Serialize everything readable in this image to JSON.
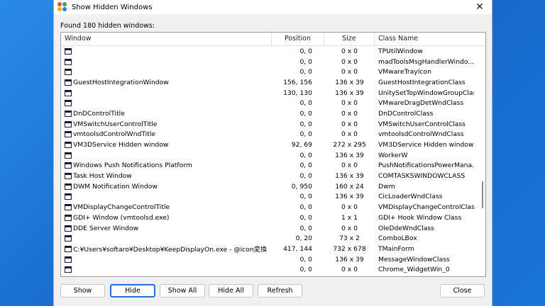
{
  "window": {
    "title": "Show Hidden Windows",
    "close_glyph": "✕"
  },
  "found_label": "Found 180 hidden windows:",
  "columns": {
    "window": "Window",
    "position": "Position",
    "size": "Size",
    "class_name": "Class Name"
  },
  "rows": [
    {
      "window": "",
      "position": "0, 0",
      "size": "0 x 0",
      "class_name": "TPUtilWindow"
    },
    {
      "window": "",
      "position": "0, 0",
      "size": "0 x 0",
      "class_name": "madToolsMsgHandlerWindo..."
    },
    {
      "window": "",
      "position": "0, 0",
      "size": "0 x 0",
      "class_name": "VMwareTrayIcon"
    },
    {
      "window": "GuestHostIntegrationWindow",
      "position": "156, 156",
      "size": "136 x 39",
      "class_name": "GuestHostIntegrationClass"
    },
    {
      "window": "",
      "position": "130, 130",
      "size": "136 x 39",
      "class_name": "UnitySetTopWindowGroupClass"
    },
    {
      "window": "",
      "position": "0, 0",
      "size": "0 x 0",
      "class_name": "VMwareDragDetWndClass"
    },
    {
      "window": "DnDControlTitle",
      "position": "0, 0",
      "size": "0 x 0",
      "class_name": "DnDControlClass"
    },
    {
      "window": "VMSwitchUserControlTitle",
      "position": "0, 0",
      "size": "0 x 0",
      "class_name": "VMSwitchUserControlClass"
    },
    {
      "window": "vmtoolsdControlWndTitle",
      "position": "0, 0",
      "size": "0 x 0",
      "class_name": "vmtoolsdControlWndClass"
    },
    {
      "window": "VM3DService Hidden window",
      "position": "92, 69",
      "size": "272 x 295",
      "class_name": "VM3DService Hidden window"
    },
    {
      "window": "",
      "position": "0, 0",
      "size": "136 x 39",
      "class_name": "WorkerW"
    },
    {
      "window": "Windows Push Notifications Platform",
      "position": "0, 0",
      "size": "0 x 0",
      "class_name": "PushNotificationsPowerMana..."
    },
    {
      "window": "Task Host Window",
      "position": "0, 0",
      "size": "136 x 39",
      "class_name": "COMTASKSWINDOWCLASS"
    },
    {
      "window": "DWM Notification Window",
      "position": "0, 950",
      "size": "160 x 24",
      "class_name": "Dwm"
    },
    {
      "window": "",
      "position": "0, 0",
      "size": "136 x 39",
      "class_name": "CicLoaderWndClass"
    },
    {
      "window": "VMDisplayChangeControlTitle",
      "position": "0, 0",
      "size": "0 x 0",
      "class_name": "VMDisplayChangeControlClass"
    },
    {
      "window": "GDI+ Window (vmtoolsd.exe)",
      "position": "0, 0",
      "size": "1 x 1",
      "class_name": "GDI+ Hook Window Class"
    },
    {
      "window": "DDE Server Window",
      "position": "0, 0",
      "size": "0 x 0",
      "class_name": "OleDdeWndClass"
    },
    {
      "window": "",
      "position": "0, 20",
      "size": "73 x 2",
      "class_name": "ComboLBox"
    },
    {
      "window": "C:¥Users¥softaro¥Desktop¥KeepDisplayOn.exe - @icon変換",
      "position": "417, 144",
      "size": "732 x 678",
      "class_name": "TMainForm"
    },
    {
      "window": "",
      "position": "0, 0",
      "size": "136 x 39",
      "class_name": "MessageWindowClass"
    },
    {
      "window": "",
      "position": "0, 0",
      "size": "0 x 0",
      "class_name": "Chrome_WidgetWin_0"
    }
  ],
  "buttons": {
    "show": "Show",
    "hide": "Hide",
    "show_all": "Show All",
    "hide_all": "Hide All",
    "refresh": "Refresh",
    "close": "Close"
  },
  "colors": {
    "desktop": "#1a73d9",
    "focus_border": "#2a6fd1",
    "dialog_bg": "#f0f0f0"
  }
}
